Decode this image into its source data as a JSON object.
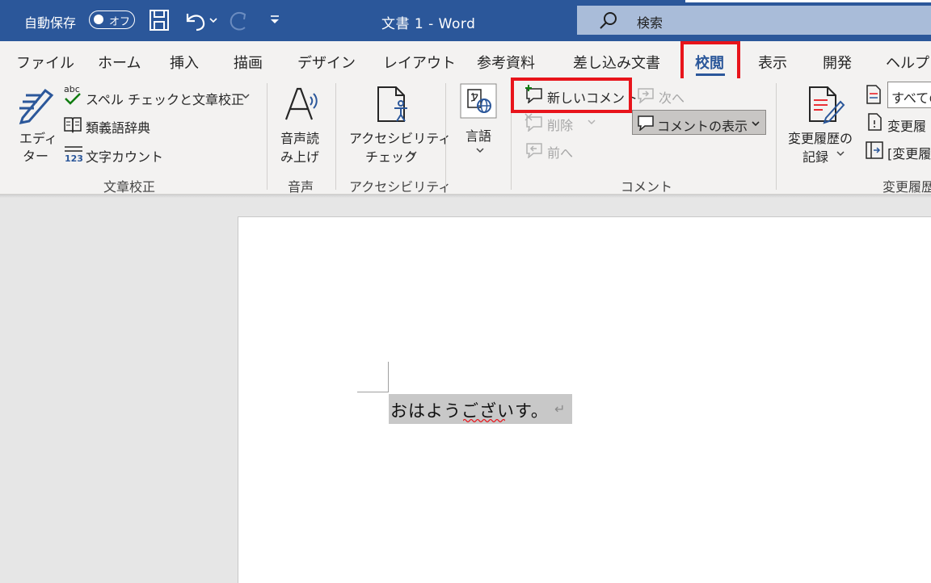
{
  "titlebar": {
    "autosave_label": "自動保存",
    "autosave_state": "オフ",
    "doc_title": "文書 1  -  Word",
    "search_placeholder": "検索"
  },
  "tabs": [
    "ファイル",
    "ホーム",
    "挿入",
    "描画",
    "デザイン",
    "レイアウト",
    "参考資料",
    "差し込み文書",
    "校閲",
    "表示",
    "開発",
    "ヘルプ"
  ],
  "active_tab": "校閲",
  "ribbon": {
    "proofing": {
      "editor": [
        "エディ",
        "ター"
      ],
      "spelling": "スペル チェックと文章校正",
      "thesaurus": "類義語辞典",
      "word_count": "文字カウント",
      "group": "文章校正"
    },
    "speech": {
      "read_aloud": [
        "音声読",
        "み上げ"
      ],
      "group": "音声"
    },
    "accessibility": {
      "check": [
        "アクセシビリティ",
        "チェック"
      ],
      "group": "アクセシビリティ"
    },
    "language": {
      "label": "言語"
    },
    "comments": {
      "new_comment": "新しいコメント",
      "delete": "削除",
      "previous": "前へ",
      "next": "次へ",
      "show_comments": "コメントの表示",
      "group": "コメント"
    },
    "tracking": {
      "track_changes": [
        "変更履歴の",
        "記録"
      ],
      "display_select": "すべての",
      "show_markup": "変更履",
      "reviewing_pane": "[変更履",
      "group": "変更履歴"
    }
  },
  "document": {
    "text": "おはようございす。",
    "paragraph_mark": "↵"
  },
  "colors": {
    "titlebar": "#2b579a",
    "ribbon": "#f3f2f1",
    "highlight_box": "#e8141b",
    "selection": "#c8c8c8"
  }
}
